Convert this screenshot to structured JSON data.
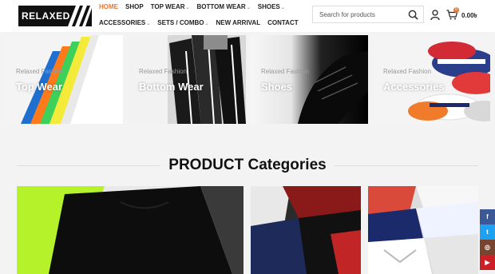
{
  "brand": {
    "logo_text": "RELAXED"
  },
  "nav": {
    "row1": [
      {
        "label": "HOME",
        "active": true,
        "dropdown": false
      },
      {
        "label": "SHOP",
        "active": false,
        "dropdown": false
      },
      {
        "label": "TOP WEAR",
        "active": false,
        "dropdown": true
      },
      {
        "label": "BOTTOM WEAR",
        "active": false,
        "dropdown": true
      },
      {
        "label": "SHOES",
        "active": false,
        "dropdown": true
      }
    ],
    "row2": [
      {
        "label": "ACCESSORIES",
        "active": false,
        "dropdown": true
      },
      {
        "label": "SETS / COMBO",
        "active": false,
        "dropdown": true
      },
      {
        "label": "NEW ARRIVAL",
        "active": false,
        "dropdown": false
      },
      {
        "label": "CONTACT",
        "active": false,
        "dropdown": false
      }
    ]
  },
  "search": {
    "placeholder": "Search for products"
  },
  "cart": {
    "count": "0",
    "total": "0.00৳"
  },
  "banners": [
    {
      "subtitle": "Relaxed Fashion",
      "title": "Top Wear"
    },
    {
      "subtitle": "Relaxed Fashion",
      "title": "Bottom Wear"
    },
    {
      "subtitle": "Relaxed Fashion",
      "title": "Shoes"
    },
    {
      "subtitle": "Relaxed Fashion",
      "title": "Accessories"
    }
  ],
  "section": {
    "title": "PRODUCT Categories"
  },
  "colors": {
    "accent": "#e8782d",
    "facebook": "#3b5998",
    "twitter": "#1da1f2",
    "instagram": "#774430",
    "youtube": "#cb2027"
  },
  "social": [
    {
      "icon": "facebook-icon",
      "glyph": "f"
    },
    {
      "icon": "twitter-icon",
      "glyph": "t"
    },
    {
      "icon": "instagram-icon",
      "glyph": "◎"
    },
    {
      "icon": "youtube-icon",
      "glyph": "▶"
    }
  ]
}
